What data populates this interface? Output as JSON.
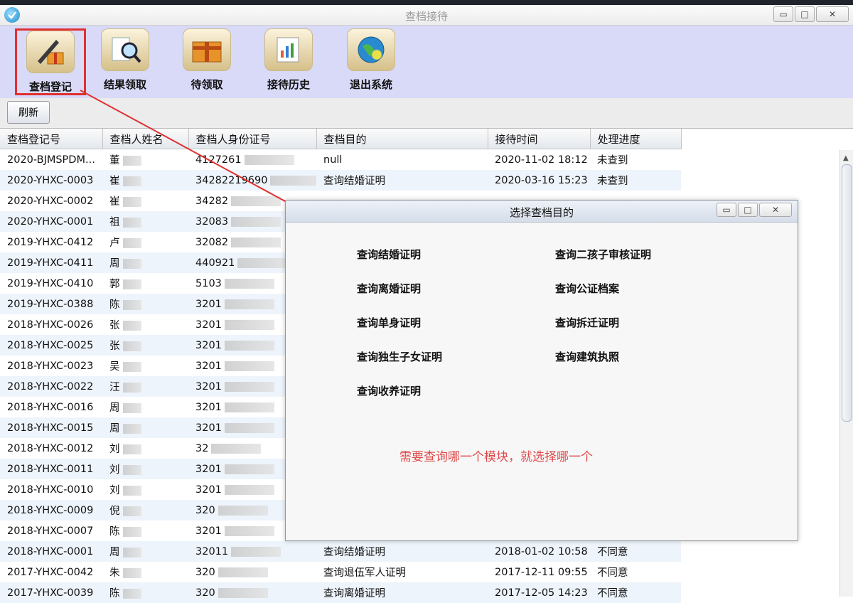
{
  "window": {
    "title": "查档接待",
    "controls": {
      "minimize": "▭",
      "maximize": "□",
      "close": "✕"
    }
  },
  "toolbar": {
    "items": [
      {
        "label": "查档登记",
        "icon": "pen-register-icon"
      },
      {
        "label": "结果领取",
        "icon": "magnifier-document-icon"
      },
      {
        "label": "待领取",
        "icon": "gift-box-icon"
      },
      {
        "label": "接待历史",
        "icon": "history-chart-icon"
      },
      {
        "label": "退出系统",
        "icon": "globe-exit-icon"
      }
    ],
    "selected_index": 0
  },
  "refresh": {
    "label": "刷新"
  },
  "table": {
    "columns": [
      "查档登记号",
      "查档人姓名",
      "查档人身份证号",
      "查档目的",
      "接待时间",
      "处理进度"
    ],
    "rows": [
      [
        "2020-BJMSPDM...",
        "董",
        "4127261",
        "null",
        "2020-11-02 18:12",
        "未查到"
      ],
      [
        "2020-YHXC-0003",
        "崔",
        "34282219690",
        "查询结婚证明",
        "2020-03-16 15:23",
        "未查到"
      ],
      [
        "2020-YHXC-0002",
        "崔",
        "34282",
        "",
        "",
        ""
      ],
      [
        "2020-YHXC-0001",
        "祖",
        "32083",
        "",
        "",
        ""
      ],
      [
        "2019-YHXC-0412",
        "卢",
        "32082",
        "",
        "",
        ""
      ],
      [
        "2019-YHXC-0411",
        "周",
        "440921",
        "",
        "",
        ""
      ],
      [
        "2019-YHXC-0410",
        "郭",
        "5103",
        "",
        "",
        ""
      ],
      [
        "2019-YHXC-0388",
        "陈",
        "3201",
        "",
        "",
        ""
      ],
      [
        "2018-YHXC-0026",
        "张",
        "3201",
        "",
        "",
        ""
      ],
      [
        "2018-YHXC-0025",
        "张",
        "3201",
        "",
        "",
        ""
      ],
      [
        "2018-YHXC-0023",
        "吴",
        "3201",
        "",
        "",
        ""
      ],
      [
        "2018-YHXC-0022",
        "汪",
        "3201",
        "",
        "",
        ""
      ],
      [
        "2018-YHXC-0016",
        "周",
        "3201",
        "",
        "",
        ""
      ],
      [
        "2018-YHXC-0015",
        "周",
        "3201",
        "",
        "",
        ""
      ],
      [
        "2018-YHXC-0012",
        "刘",
        "32",
        "",
        "",
        ""
      ],
      [
        "2018-YHXC-0011",
        "刘",
        "3201",
        "",
        "",
        ""
      ],
      [
        "2018-YHXC-0010",
        "刘",
        "3201",
        "",
        "",
        ""
      ],
      [
        "2018-YHXC-0009",
        "倪",
        "320",
        "",
        "",
        ""
      ],
      [
        "2018-YHXC-0007",
        "陈",
        "3201",
        "",
        "",
        ""
      ],
      [
        "2018-YHXC-0001",
        "周",
        "32011",
        "查询结婚证明",
        "2018-01-02 10:58",
        "不同意"
      ],
      [
        "2017-YHXC-0042",
        "朱",
        "320",
        "查询退伍军人证明",
        "2017-12-11 09:55",
        "不同意"
      ],
      [
        "2017-YHXC-0039",
        "陈",
        "320",
        "查询离婚证明",
        "2017-12-05 14:23",
        "不同意"
      ]
    ]
  },
  "dialog": {
    "title": "选择查档目的",
    "options_left": [
      "查询结婚证明",
      "查询离婚证明",
      "查询单身证明",
      "查询独生子女证明",
      "查询收养证明"
    ],
    "options_right": [
      "查询二孩子审核证明",
      "查询公证档案",
      "查询拆迁证明",
      "查询建筑执照"
    ],
    "hint": "需要查询哪一个模块，就选择哪一个"
  },
  "colors": {
    "toolbar_bg": "#d9daf8",
    "highlight_red": "#e03030",
    "row_alt": "#eef4fb",
    "hint_red": "#e04848"
  }
}
